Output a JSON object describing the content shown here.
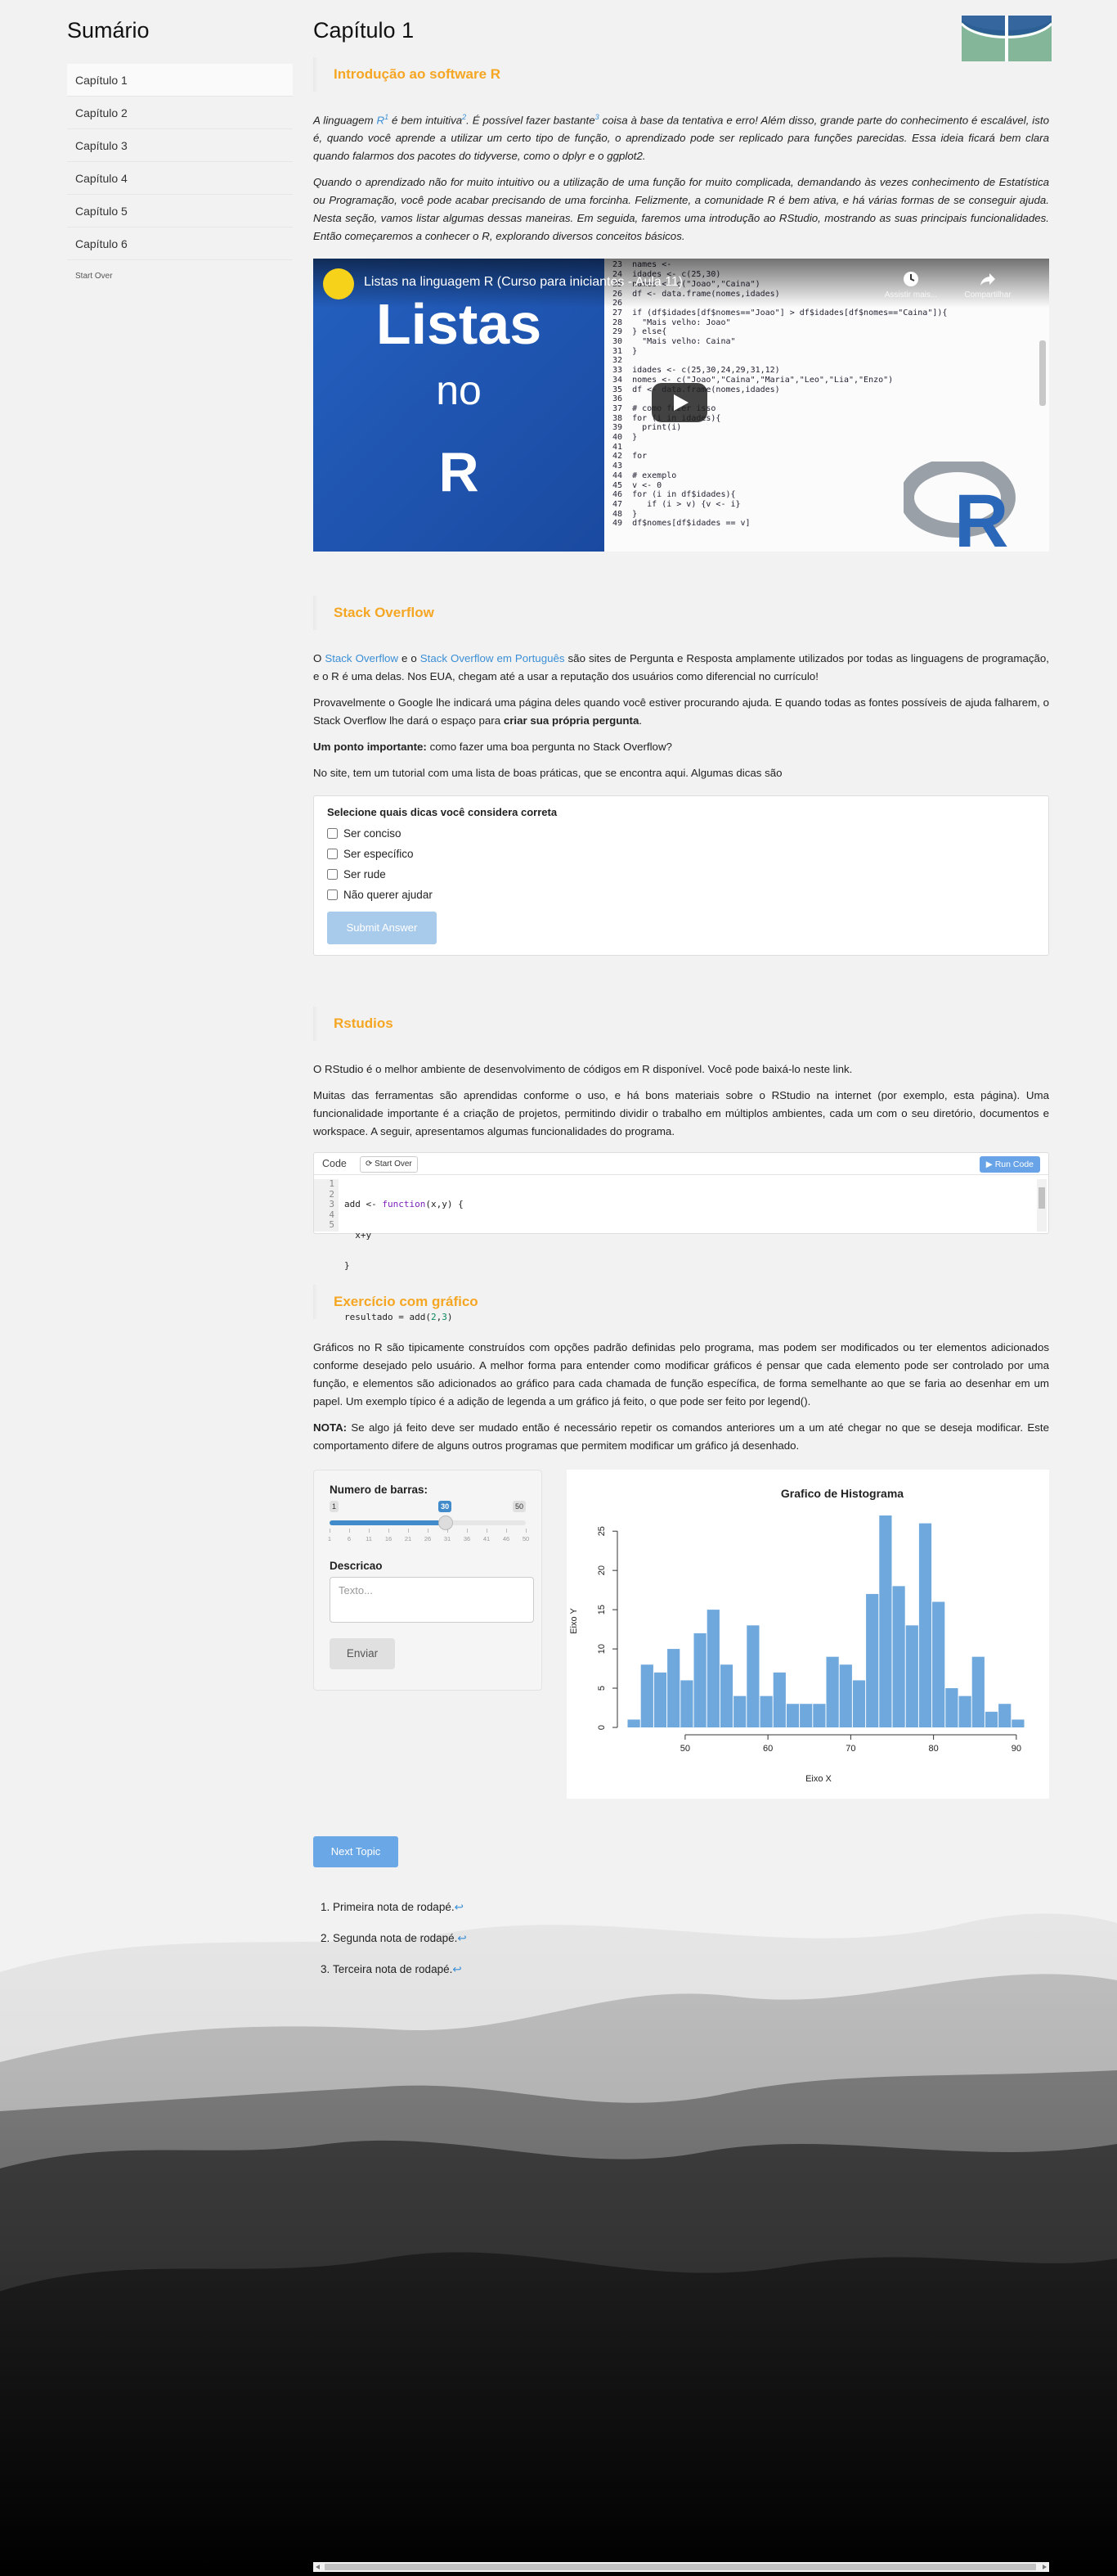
{
  "sidebar": {
    "title": "Sumário",
    "items": [
      "Capítulo 1",
      "Capítulo 2",
      "Capítulo 3",
      "Capítulo 4",
      "Capítulo 5",
      "Capítulo 6"
    ],
    "start_over": "Start Over"
  },
  "chapter": {
    "title": "Capítulo 1"
  },
  "intro": {
    "title": "Introdução ao software R",
    "p1_a": "A linguagem ",
    "p1_link": "R",
    "p1_sup1": "1",
    "p1_b": " é bem intuitiva",
    "p1_sup2": "2",
    "p1_c": ". É possível fazer bastante",
    "p1_sup3": "3",
    "p1_d": " coisa à base da tentativa e erro! Além disso, grande parte do conhecimento é escalável, isto é, quando você aprende a utilizar um certo tipo de função, o aprendizado pode ser replicado para funções parecidas. Essa ideia ficará bem clara quando falarmos dos pacotes do tidyverse, como o dplyr e o ggplot2.",
    "p2": "Quando o aprendizado não for muito intuitivo ou a utilização de uma função for muito complicada, demandando às vezes conhecimento de Estatística ou Programação, você pode acabar precisando de uma forcinha. Felizmente, a comunidade R é bem ativa, e há várias formas de se conseguir ajuda. Nesta seção, vamos listar algumas dessas maneiras. Em seguida, faremos uma introdução ao RStudio, mostrando as suas principais funcionalidades. Então começaremos a conhecer o R, explorando diversos conceitos básicos."
  },
  "video": {
    "title": "Listas na linguagem R (Curso para iniciantes - Aula 11)",
    "thumb_line1": "Listas",
    "thumb_line2": "no",
    "thumb_line3": "R",
    "watch_later": "Assistir mais...",
    "share": "Compartilhar",
    "code_lines": [
      "23  names <-",
      "24  idades <- c(25,30)",
      "25  names <- c(\"Joao\",\"Caina\")",
      "26  df <- data.frame(nomes,idades)",
      "26",
      "27  if (df$idades[df$nomes==\"Joao\"] > df$idades[df$nomes==\"Caina\"]){",
      "28    \"Mais velho: Joao\"",
      "29  } else{",
      "30    \"Mais velho: Caina\"",
      "31  }",
      "32",
      "33  idades <- c(25,30,24,29,31,12)",
      "34  nomes <- c(\"Joao\",\"Caina\",\"Maria\",\"Leo\",\"Lia\",\"Enzo\")",
      "35  df <- data.frame(nomes,idades)",
      "36",
      "37  # como fazer isso",
      "38  for (i in idades){",
      "39    print(i)",
      "40  }",
      "41",
      "42  for",
      "43",
      "44  # exemplo",
      "45  v <- 0",
      "46  for (i in df$idades){",
      "47     if (i > v) {v <- i}",
      "48  }",
      "49  df$nomes[df$idades == v]"
    ]
  },
  "stack": {
    "title": "Stack Overflow",
    "p1_a": "O ",
    "p1_link1": "Stack Overflow",
    "p1_b": " e o ",
    "p1_link2": "Stack Overflow em Português",
    "p1_c": " são sites de Pergunta e Resposta amplamente utilizados por todas as linguagens de programação, e o R é uma delas. Nos EUA, chegam até a usar a reputação dos usuários como diferencial no currículo!",
    "p2_a": "Provavelmente o Google lhe indicará uma página deles quando você estiver procurando ajuda. E quando todas as fontes possíveis de ajuda falharem, o Stack Overflow lhe dará o espaço para ",
    "p2_bold": "criar sua própria pergunta",
    "p2_end": ".",
    "p3_bold": "Um ponto importante:",
    "p3_rest": " como fazer uma boa pergunta no Stack Overflow?",
    "p4": "No site, tem um tutorial com uma lista de boas práticas, que se encontra aqui. Algumas dicas são"
  },
  "quiz": {
    "question": "Selecione quais dicas você considera correta",
    "options": [
      "Ser conciso",
      "Ser específico",
      "Ser rude",
      "Não querer ajudar"
    ],
    "submit": "Submit Answer"
  },
  "rstudio": {
    "title": "Rstudios",
    "p1": "O RStudio é o melhor ambiente de desenvolvimento de códigos em R disponível. Você pode baixá-lo neste link.",
    "p2": "Muitas das ferramentas são aprendidas conforme o uso, e há bons materiais sobre o RStudio na internet (por exemplo, esta página). Uma funcionalidade importante é a criação de projetos, permitindo dividir o trabalho em múltiplos ambientes, cada um com o seu diretório, documentos e workspace. A seguir, apresentamos algumas funcionalidades do programa."
  },
  "exercise": {
    "code_label": "Code",
    "start_over": "Start Over",
    "run": "Run Code",
    "line_numbers": "1\n2\n3\n4\n5",
    "l1_a": "add <- ",
    "l1_kw": "function",
    "l1_b": "(x,y) {",
    "l2": "  x+y",
    "l3": "}",
    "l4": "",
    "l5_a": "resultado = add(",
    "l5_n1": "2",
    "l5_c": ",",
    "l5_n2": "3",
    "l5_d": ")"
  },
  "graph": {
    "title": "Exercício com gráfico",
    "p1": "Gráficos no R são tipicamente construídos com opções padrão definidas pelo programa, mas podem ser modificados ou ter elementos adicionados conforme desejado pelo usuário. A melhor forma para entender como modificar gráficos é pensar que cada elemento pode ser controlado por uma função, e elementos são adicionados ao gráfico para cada chamada de função específica, de forma semelhante ao que se faria ao desenhar em um papel. Um exemplo típico é a adição de legenda a um gráfico já feito, o que pode ser feito por legend().",
    "p2_bold": "NOTA:",
    "p2_rest": " Se algo já feito deve ser mudado então é necessário repetir os comandos anteriores um a um até chegar no que se deseja modificar. Este comportamento difere de alguns outros programas que permitem modificar um gráfico já desenhado."
  },
  "app": {
    "slider_label": "Numero de barras:",
    "slider_min": "1",
    "slider_max": "50",
    "slider_value": "30",
    "slider_fraction": 0.592,
    "slider_ticks": [
      "1",
      "6",
      "11",
      "16",
      "21",
      "26",
      "31",
      "36",
      "41",
      "46",
      "50"
    ],
    "desc_label": "Descricao",
    "desc_placeholder": "Texto...",
    "send": "Enviar"
  },
  "chart_data": {
    "type": "bar",
    "title": "Grafico de Histograma",
    "xlabel": "Eixo X",
    "ylabel": "Eixo Y",
    "bin_start": 43,
    "bin_width": 1.6,
    "values": [
      1,
      8,
      7,
      10,
      6,
      12,
      15,
      8,
      4,
      13,
      4,
      7,
      3,
      3,
      3,
      9,
      8,
      6,
      17,
      27,
      18,
      13,
      26,
      16,
      5,
      4,
      9,
      2,
      3,
      1
    ],
    "xlim": [
      43,
      91
    ],
    "ylim": [
      0,
      27
    ],
    "xticks": [
      50,
      60,
      70,
      80,
      90
    ],
    "yticks": [
      0,
      5,
      10,
      15,
      20,
      25
    ],
    "bar_color": "#6fa8dc",
    "grid": false
  },
  "nav": {
    "next_topic": "Next Topic"
  },
  "footnotes": {
    "items": [
      "Primeira nota de rodapé.",
      "Segunda nota de rodapé.",
      "Terceira nota de rodapé."
    ],
    "back_symbol": "↩"
  },
  "colors": {
    "accent": "#f5a623",
    "link": "#3b8fd6",
    "button": "#6aa7e6"
  }
}
